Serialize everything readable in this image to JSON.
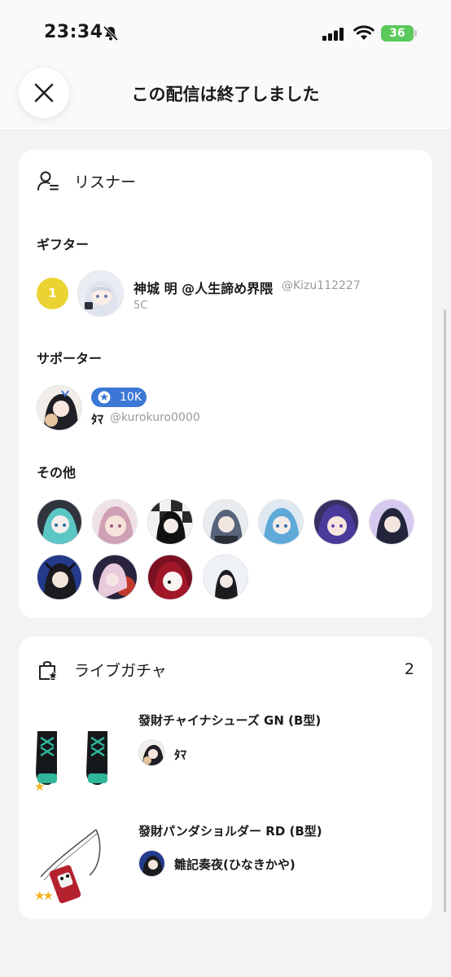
{
  "status_bar": {
    "time": "23:34",
    "battery": "36"
  },
  "header": {
    "title": "この配信は終了しました"
  },
  "listeners": {
    "title": "リスナー",
    "gifter": {
      "heading": "ギフター",
      "rank": "1",
      "name": "神城 明 @人生諦め界隈",
      "handle": "@Kizu112227",
      "amount": "5C"
    },
    "supporter": {
      "heading": "サポーター",
      "badge": "10K",
      "name": "ﾀﾏ",
      "handle": "@kurokuro0000"
    },
    "others": {
      "heading": "その他"
    }
  },
  "gacha": {
    "title": "ライブガチャ",
    "count": "2",
    "items": [
      {
        "name": "發財チャイナシューズ GN (B型)",
        "owner": "ﾀﾏ"
      },
      {
        "name": "發財パンダショルダー RD (B型)",
        "owner": "雛記奏夜(ひなきかや)"
      }
    ]
  },
  "colors": {
    "rank_gold": "#ecd334",
    "badge_blue": "#3c77d6",
    "star": "#f5b21c",
    "battery_green": "#5ac85a"
  }
}
